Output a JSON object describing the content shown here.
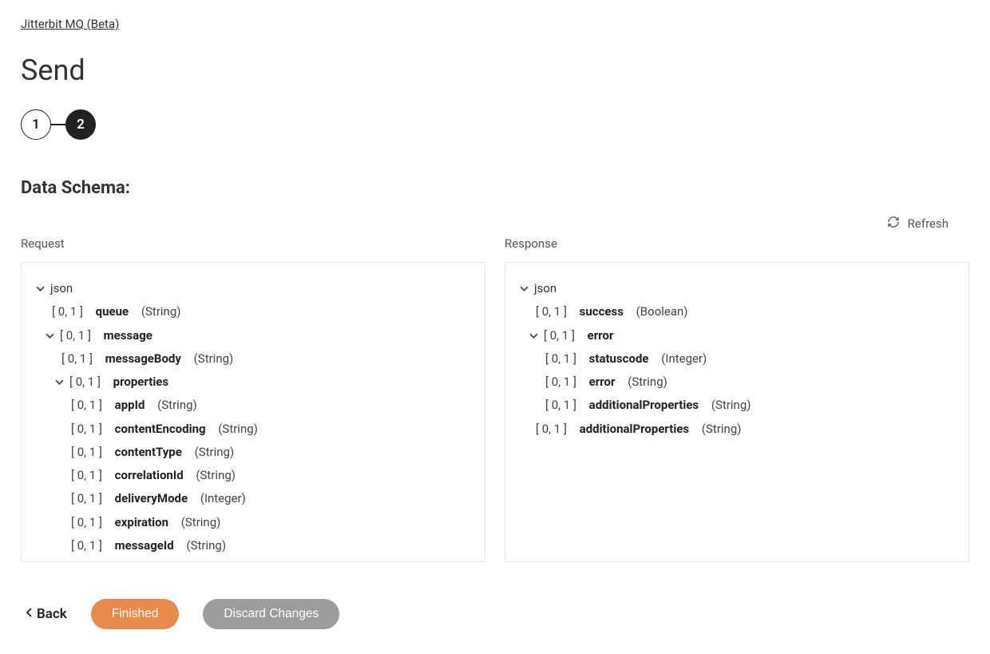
{
  "breadcrumb": "Jitterbit MQ (Beta)",
  "page_title": "Send",
  "stepper": {
    "step1": "1",
    "step2": "2"
  },
  "section_title": "Data Schema:",
  "refresh_label": "Refresh",
  "panels": {
    "request_label": "Request",
    "response_label": "Response"
  },
  "request_tree": {
    "root": "json",
    "queue": {
      "card": "[ 0, 1 ]",
      "name": "queue",
      "type": "(String)"
    },
    "message": {
      "card": "[ 0, 1 ]",
      "name": "message"
    },
    "messageBody": {
      "card": "[ 0, 1 ]",
      "name": "messageBody",
      "type": "(String)"
    },
    "properties": {
      "card": "[ 0, 1 ]",
      "name": "properties"
    },
    "appId": {
      "card": "[ 0, 1 ]",
      "name": "appId",
      "type": "(String)"
    },
    "contentEncoding": {
      "card": "[ 0, 1 ]",
      "name": "contentEncoding",
      "type": "(String)"
    },
    "contentType": {
      "card": "[ 0, 1 ]",
      "name": "contentType",
      "type": "(String)"
    },
    "correlationId": {
      "card": "[ 0, 1 ]",
      "name": "correlationId",
      "type": "(String)"
    },
    "deliveryMode": {
      "card": "[ 0, 1 ]",
      "name": "deliveryMode",
      "type": "(Integer)"
    },
    "expiration": {
      "card": "[ 0, 1 ]",
      "name": "expiration",
      "type": "(String)"
    },
    "messageId": {
      "card": "[ 0, 1 ]",
      "name": "messageId",
      "type": "(String)"
    }
  },
  "response_tree": {
    "root": "json",
    "success": {
      "card": "[ 0, 1 ]",
      "name": "success",
      "type": "(Boolean)"
    },
    "error": {
      "card": "[ 0, 1 ]",
      "name": "error"
    },
    "statuscode": {
      "card": "[ 0, 1 ]",
      "name": "statuscode",
      "type": "(Integer)"
    },
    "error2": {
      "card": "[ 0, 1 ]",
      "name": "error",
      "type": "(String)"
    },
    "addlProps": {
      "card": "[ 0, 1 ]",
      "name": "additionalProperties",
      "type": "(String)"
    },
    "addlProps2": {
      "card": "[ 0, 1 ]",
      "name": "additionalProperties",
      "type": "(String)"
    }
  },
  "footer": {
    "back": "Back",
    "finished": "Finished",
    "discard": "Discard Changes"
  }
}
